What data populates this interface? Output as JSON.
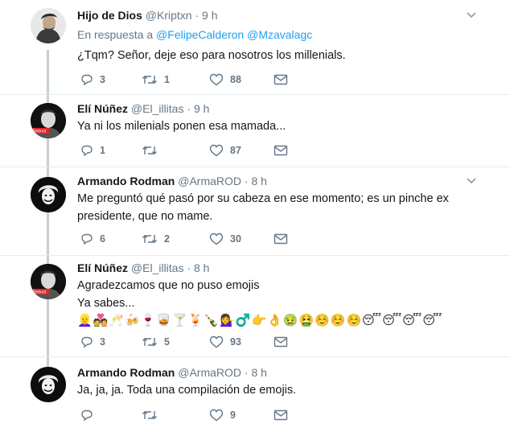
{
  "tweets": [
    {
      "name": "Hijo de Dios",
      "handle": "@Kriptxn",
      "time": "9 h",
      "reply_prefix": "En respuesta a",
      "mentions": [
        "@FelipeCalderon",
        "@Mzavalagc"
      ],
      "lines": [
        "¿Tqm? Señor, deje eso para nosotros los millenials."
      ],
      "replies": "3",
      "retweets": "1",
      "likes": "88"
    },
    {
      "name": "Elí Núñez",
      "handle": "@El_illitas",
      "time": "9 h",
      "lines": [
        "Ya ni los milenials ponen esa mamada..."
      ],
      "replies": "1",
      "retweets": "",
      "likes": "87",
      "avatar_badge": "Reboot"
    },
    {
      "name": "Armando Rodman",
      "handle": "@ArmaROD",
      "time": "8 h",
      "lines": [
        "Me preguntó qué pasó por su cabeza en ese momento; es un pinche ex",
        "presidente, que no mame."
      ],
      "replies": "6",
      "retweets": "2",
      "likes": "30"
    },
    {
      "name": "Elí Núñez",
      "handle": "@El_illitas",
      "time": "8 h",
      "lines": [
        "Agradezcamos que no puso emojis",
        "Ya sabes..."
      ],
      "emojis": "👱‍♀️💑🥂🍻🍷🥃🍸🍹🍾💁‍♀️♂️👉👌🤢🤮☺️☺️☺️😴😴😴😴",
      "replies": "3",
      "retweets": "5",
      "likes": "93",
      "avatar_badge": "Reboot"
    },
    {
      "name": "Armando Rodman",
      "handle": "@ArmaROD",
      "time": "8 h",
      "lines": [
        "Ja, ja, ja. Toda una compilación de emojis."
      ],
      "replies": "",
      "retweets": "",
      "likes": "9"
    }
  ],
  "separator": "·",
  "icons": {
    "reply": "reply-icon",
    "retweet": "retweet-icon",
    "like": "heart-icon",
    "dm": "envelope-icon",
    "more": "chevron-down-icon"
  },
  "colors": {
    "text": "#14171a",
    "muted": "#657786",
    "link": "#1da1f2",
    "thread_line": "#c4cfd6",
    "divider": "#e6ecf0"
  }
}
